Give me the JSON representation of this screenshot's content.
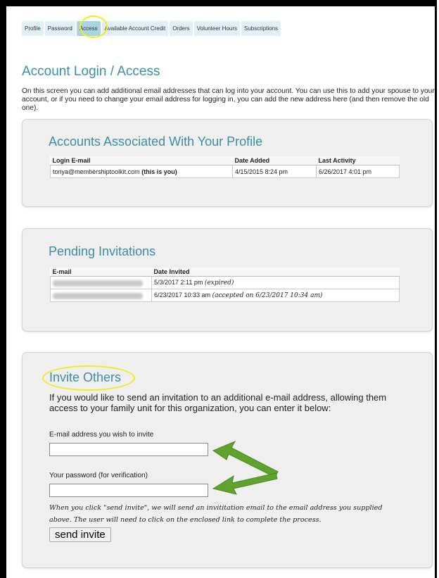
{
  "tabs": [
    {
      "label": "Profile",
      "active": false
    },
    {
      "label": "Password",
      "active": false
    },
    {
      "label": "Access",
      "active": true
    },
    {
      "label": "Available Account Credit",
      "active": false
    },
    {
      "label": "Orders",
      "active": false
    },
    {
      "label": "Volunteer Hours",
      "active": false
    },
    {
      "label": "Subscriptions",
      "active": false
    }
  ],
  "page": {
    "title": "Account Login / Access",
    "intro": "On this screen you can add additional email addresses that can log into your account. You can use this to add your spouse to your account, or if you need to change your email address for logging in, you can add the new address here (and then remove the old one)."
  },
  "accounts": {
    "title": "Accounts Associated With Your Profile",
    "headers": [
      "Login E-mail",
      "Date Added",
      "Last Activity"
    ],
    "rows": [
      {
        "email": "tonya@membershiptoolkit.com",
        "suffix": "(this is you)",
        "date_added": "4/15/2015 8:24 pm",
        "last_activity": "6/26/2017 4:01 pm"
      }
    ]
  },
  "pending": {
    "title": "Pending Invitations",
    "headers": [
      "E-mail",
      "Date Invited"
    ],
    "rows": [
      {
        "date": "5/3/2017 2:11 pm",
        "status": "(expired)"
      },
      {
        "date": "6/23/2017 10:33 am",
        "status": "(accepted on 6/23/2017 10:34 am)"
      }
    ]
  },
  "invite": {
    "title": "Invite Others",
    "description": "If you would like to send an invitation to an additional e-mail address, allowing them access to your family unit for this organization, you can enter it below:",
    "email_label": "E-mail address you wish to invite",
    "email_value": "",
    "password_label": "Your password (for verification)",
    "password_value": "",
    "note": "When you click \"send invite\", we will send an invititation email to the email address you supplied above. The user will need to click on the enclosed link to complete the process.",
    "button_label": "send invite"
  },
  "colors": {
    "accent": "#3b8ea5",
    "highlight": "#f3ec21",
    "arrow": "#5fa32c"
  }
}
